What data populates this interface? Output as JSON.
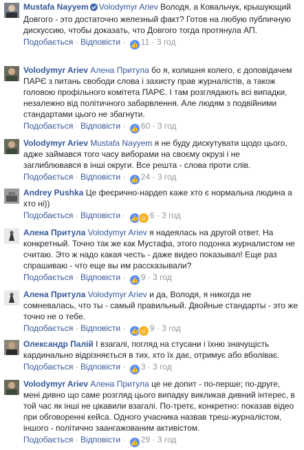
{
  "comments": [
    {
      "author": "Mustafa Nayyem",
      "verified": true,
      "mention": "Volodymyr Ariev",
      "text": " Володя, а Ковальчук, крышующий Довгого - это достаточно железный факт? Готов на любую публичную дискуссию, чтобы доказать, что Довгого тогда протянула АП.",
      "like": "Подобається",
      "reply": "Відповісти",
      "reactions": [
        "like"
      ],
      "count": "11",
      "time": "3 год"
    },
    {
      "author": "Volodymyr Ariev",
      "mention": "Алена Притула",
      "text": " бо я, колишня колего, є доповідачем ПАРЄ з питань свободи слова і захисту прав журналістів, а також головою профільного комітета ПАРЄ. І там розглядають всі випадки, незалежно від політичного забарвлення. Але людям з подвійними стандартами цього не збагнути.",
      "like": "Подобається",
      "reply": "Відповісти",
      "reactions": [
        "like"
      ],
      "count": "60",
      "time": "3 год"
    },
    {
      "author": "Volodymyr Ariev",
      "mention": "Mustafa Nayyem",
      "text": " я не буду дискутувати щодо цього, адже займався того часу виборами на своєму окрузі і не заглиблювався в інші округи. Все решта - слова проти слів.",
      "like": "Подобається",
      "reply": "Відповісти",
      "reactions": [
        "like"
      ],
      "count": "24",
      "time": "3 год"
    },
    {
      "author": "Andrey Pushka",
      "mention": "",
      "text": " Це феєрично-нардеп каже хто є нормальна людина а хто ні))",
      "like": "Подобається",
      "reply": "Відповісти",
      "reactions": [
        "like",
        "haha"
      ],
      "count": "6",
      "time": "3 год"
    },
    {
      "author": "Алена Притула",
      "mention": "Volodymyr Ariev",
      "text": " я надеялась на другой ответ. На конкретный. Точно так же как Мустафа, этого подонка журналистом не считаю. Это ж надо какая честь - даже видео показывал! Еще раз спрашиваю - что еще вы им рассказывали?",
      "like": "Подобається",
      "reply": "Відповісти",
      "reactions": [
        "like"
      ],
      "count": "9",
      "time": "3 год"
    },
    {
      "author": "Алена Притула",
      "mention": "Volodymyr Ariev",
      "text": " и да, Володя, я никогда не сомневалась, что ты - самый правильный. Двойные стандарты - это же точно не о тебе.",
      "like": "Подобається",
      "reply": "Відповісти",
      "reactions": [
        "like",
        "haha"
      ],
      "count": "9",
      "time": "3 год"
    },
    {
      "author": "Олександр Палій",
      "mention": "",
      "text": " І взагалі, погляд на стусани і їхню значущість кардинально відрізняється в тих, хто їх дає, отримує або вболіває.",
      "like": "Подобається",
      "reply": "Відповісти",
      "reactions": [
        "like"
      ],
      "count": "3",
      "time": "3 год"
    },
    {
      "author": "Volodymyr Ariev",
      "mention": "Алена Притула",
      "text": " це не допит - по-перше; по-друге, мені дивно що саме розгляд цього випадку викликав дивний інтерес, в той час як інші не цікавили взагалі. По-третє, конкретно: показав відео при обговоренні кейса. Одного учасника назвав треш-журналістом, іншого - політично заангажованим активістом.",
      "like": "Подобається",
      "reply": "Відповісти",
      "reactions": [
        "like"
      ],
      "count": "29",
      "time": "3 год"
    }
  ]
}
